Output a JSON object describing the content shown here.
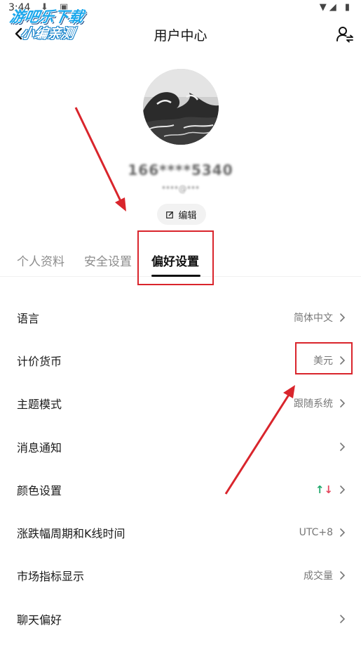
{
  "status_bar": {
    "time": "3:44",
    "left_icons": "⬇ ▣",
    "right_icons": "▼◢ ▮"
  },
  "watermark": {
    "line1": "游吧乐下载",
    "line2": "小编亲测"
  },
  "header": {
    "title": "用户中心",
    "back_icon": "chevron-left-icon",
    "user_switch_icon": "user-switch-icon"
  },
  "profile": {
    "masked_phone": "166****5340",
    "masked_email": "****@***",
    "edit_label": "编辑",
    "edit_icon": "edit-icon"
  },
  "tabs": [
    {
      "label": "个人资料",
      "active": false
    },
    {
      "label": "安全设置",
      "active": false
    },
    {
      "label": "偏好设置",
      "active": true
    }
  ],
  "settings": [
    {
      "label": "语言",
      "value": "简体中文"
    },
    {
      "label": "计价货币",
      "value": "美元"
    },
    {
      "label": "主题模式",
      "value": "跟随系统"
    },
    {
      "label": "消息通知",
      "value": ""
    },
    {
      "label": "颜色设置",
      "value": "",
      "arrows": {
        "up": "↑",
        "down": "↓",
        "up_color": "#1fa86b",
        "down_color": "#e5475d"
      }
    },
    {
      "label": "涨跌幅周期和K线时间",
      "value": "UTC+8"
    },
    {
      "label": "市场指标显示",
      "value": "成交量"
    },
    {
      "label": "聊天偏好",
      "value": ""
    }
  ],
  "annotation_color": "#d9252c"
}
